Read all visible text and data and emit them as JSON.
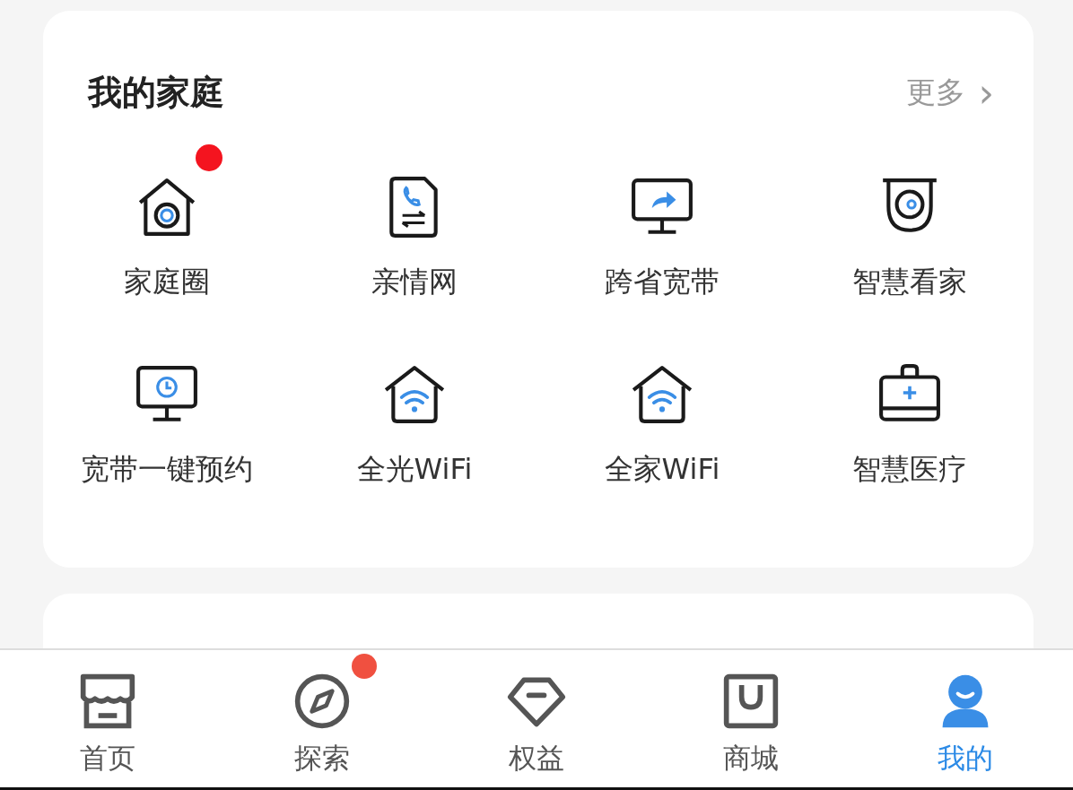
{
  "family_card": {
    "title": "我的家庭",
    "more": "更多",
    "more_arrow": "›",
    "items": [
      {
        "label": "家庭圈",
        "badge": true
      },
      {
        "label": "亲情网",
        "badge": false
      },
      {
        "label": "跨省宽带",
        "badge": false
      },
      {
        "label": "智慧看家",
        "badge": false
      },
      {
        "label": "宽带一键预约",
        "badge": false
      },
      {
        "label": "全光WiFi",
        "badge": false
      },
      {
        "label": "全家WiFi",
        "badge": false
      },
      {
        "label": "智慧医疗",
        "badge": false
      }
    ]
  },
  "bottom_nav": [
    {
      "label": "首页",
      "selected": false,
      "badge": false
    },
    {
      "label": "探索",
      "selected": false,
      "badge": true
    },
    {
      "label": "权益",
      "selected": false,
      "badge": false
    },
    {
      "label": "商城",
      "selected": false,
      "badge": false
    },
    {
      "label": "我的",
      "selected": true,
      "badge": false
    }
  ]
}
